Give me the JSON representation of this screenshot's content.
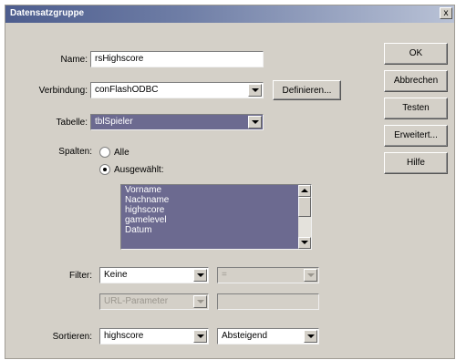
{
  "window": {
    "title": "Datensatzgruppe",
    "close_symbol": "x"
  },
  "form": {
    "name": {
      "label": "Name:",
      "value": "rsHighscore"
    },
    "connection": {
      "label": "Verbindung:",
      "value": "conFlashODBC",
      "define_button": "Definieren..."
    },
    "table": {
      "label": "Tabelle:",
      "value": "tblSpieler"
    },
    "columns": {
      "label": "Spalten:",
      "option_all": "Alle",
      "option_selected": "Ausgewählt:",
      "selected_option": "Ausgewählt:",
      "items": [
        "Vorname",
        "Nachname",
        "highscore",
        "gamelevel",
        "Datum"
      ]
    },
    "filter": {
      "label": "Filter:",
      "value": "Keine",
      "operator": "=",
      "param_type": "URL-Parameter",
      "param_value": ""
    },
    "sort": {
      "label": "Sortieren:",
      "value": "highscore",
      "order": "Absteigend"
    }
  },
  "buttons": {
    "ok": "OK",
    "cancel": "Abbrechen",
    "test": "Testen",
    "advanced": "Erweitert...",
    "help": "Hilfe"
  }
}
